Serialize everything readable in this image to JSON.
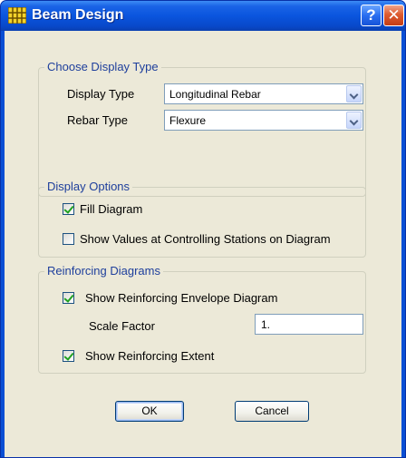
{
  "window": {
    "title": "Beam Design",
    "help_glyph": "?",
    "close_glyph": "✕"
  },
  "display_type_group": {
    "title": "Choose Display Type",
    "display_type_label": "Display Type",
    "display_type_value": "Longitudinal Rebar",
    "rebar_type_label": "Rebar Type",
    "rebar_type_value": "Flexure"
  },
  "display_options_group": {
    "title": "Display Options",
    "fill_diagram_label": "Fill Diagram",
    "fill_diagram_checked": true,
    "show_values_label": "Show Values at Controlling Stations on Diagram",
    "show_values_checked": false
  },
  "reinforcing_group": {
    "title": "Reinforcing Diagrams",
    "envelope_label": "Show Reinforcing Envelope Diagram",
    "envelope_checked": true,
    "scale_factor_label": "Scale Factor",
    "scale_factor_value": "1.",
    "extent_label": "Show Reinforcing Extent",
    "extent_checked": true
  },
  "buttons": {
    "ok_label": "OK",
    "cancel_label": "Cancel"
  },
  "colors": {
    "titlebar": "#0a55de",
    "dialog_bg": "#ece9d8",
    "group_title": "#1e3f9c",
    "checkmark": "#21a121"
  }
}
